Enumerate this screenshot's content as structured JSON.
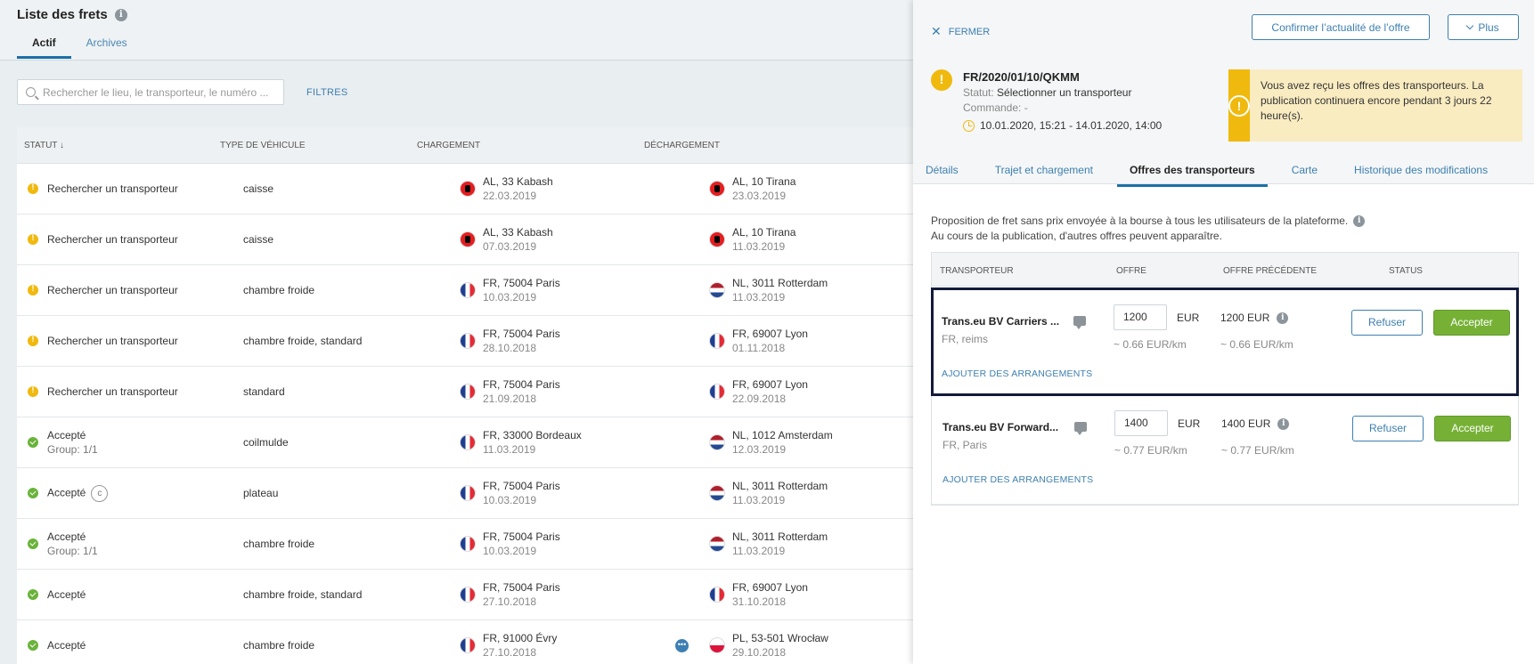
{
  "list": {
    "title": "Liste des frets",
    "tabs": [
      {
        "label": "Actif"
      },
      {
        "label": "Archives"
      }
    ],
    "search_placeholder": "Rechercher le lieu, le transporteur, le numéro ...",
    "filters_label": "FILTRES",
    "columns": {
      "status": "STATUT",
      "vehicle": "TYPE DE VÉHICULE",
      "loading": "CHARGEMENT",
      "unloading": "DÉCHARGEMENT"
    },
    "rows": [
      {
        "status": "Rechercher un transporteur",
        "status_sub": "",
        "kind": "warn",
        "vehicle": "caisse",
        "load_place": "AL, 33 Kabash",
        "load_date": "22.03.2019",
        "load_flag": "al",
        "unload_place": "AL, 10 Tirana",
        "unload_date": "23.03.2019",
        "unload_flag": "al"
      },
      {
        "status": "Rechercher un transporteur",
        "status_sub": "",
        "kind": "warn",
        "vehicle": "caisse",
        "load_place": "AL, 33 Kabash",
        "load_date": "07.03.2019",
        "load_flag": "al",
        "unload_place": "AL, 10 Tirana",
        "unload_date": "11.03.2019",
        "unload_flag": "al"
      },
      {
        "status": "Rechercher un transporteur",
        "status_sub": "",
        "kind": "warn",
        "vehicle": "chambre froide",
        "load_place": "FR, 75004 Paris",
        "load_date": "10.03.2019",
        "load_flag": "fr",
        "unload_place": "NL, 3011 Rotterdam",
        "unload_date": "11.03.2019",
        "unload_flag": "nl"
      },
      {
        "status": "Rechercher un transporteur",
        "status_sub": "",
        "kind": "warn",
        "vehicle": "chambre froide, standard",
        "load_place": "FR, 75004 Paris",
        "load_date": "28.10.2018",
        "load_flag": "fr",
        "unload_place": "FR, 69007 Lyon",
        "unload_date": "01.11.2018",
        "unload_flag": "fr"
      },
      {
        "status": "Rechercher un transporteur",
        "status_sub": "",
        "kind": "warn",
        "vehicle": "standard",
        "load_place": "FR, 75004 Paris",
        "load_date": "21.09.2018",
        "load_flag": "fr",
        "unload_place": "FR, 69007 Lyon",
        "unload_date": "22.09.2018",
        "unload_flag": "fr"
      },
      {
        "status": "Accepté",
        "status_sub": "Group: 1/1",
        "kind": "ok",
        "vehicle": "coilmulde",
        "load_place": "FR, 33000 Bordeaux",
        "load_date": "11.03.2019",
        "load_flag": "fr",
        "unload_place": "NL, 1012 Amsterdam",
        "unload_date": "12.03.2019",
        "unload_flag": "nl"
      },
      {
        "status": "Accepté",
        "status_sub": "",
        "badge": "c",
        "kind": "ok",
        "vehicle": "plateau",
        "load_place": "FR, 75004 Paris",
        "load_date": "10.03.2019",
        "load_flag": "fr",
        "unload_place": "NL, 3011 Rotterdam",
        "unload_date": "11.03.2019",
        "unload_flag": "nl"
      },
      {
        "status": "Accepté",
        "status_sub": "Group: 1/1",
        "kind": "ok",
        "vehicle": "chambre froide",
        "load_place": "FR, 75004 Paris",
        "load_date": "10.03.2019",
        "load_flag": "fr",
        "unload_place": "NL, 3011 Rotterdam",
        "unload_date": "11.03.2019",
        "unload_flag": "nl"
      },
      {
        "status": "Accepté",
        "status_sub": "",
        "kind": "ok",
        "vehicle": "chambre froide, standard",
        "load_place": "FR, 75004 Paris",
        "load_date": "27.10.2018",
        "load_flag": "fr",
        "unload_place": "FR, 69007 Lyon",
        "unload_date": "31.10.2018",
        "unload_flag": "fr"
      },
      {
        "status": "Accepté",
        "status_sub": "",
        "kind": "ok",
        "vehicle": "chambre froide",
        "load_place": "FR, 91000 Évry",
        "load_date": "27.10.2018",
        "load_flag": "fr",
        "unload_place": "PL, 53-501 Wrocław",
        "unload_date": "29.10.2018",
        "unload_flag": "pl",
        "chat": true
      }
    ]
  },
  "detail": {
    "close_label": "FERMER",
    "confirm_label": "Confirmer l’actualité de l’offre",
    "more_label": "Plus",
    "reference": "FR/2020/01/10/QKMM",
    "status_label": "Statut:",
    "status_value": "Sélectionner un transporteur",
    "order_label": "Commande:",
    "order_value": "-",
    "period": "10.01.2020, 15:21 - 14.01.2020, 14:00",
    "notice": "Vous avez reçu les offres des transporteurs. La publication continuera encore pendant 3 jours 22 heure(s).",
    "tabs": [
      {
        "label": "Détails"
      },
      {
        "label": "Trajet et chargement"
      },
      {
        "label": "Offres des transporteurs",
        "active": true
      },
      {
        "label": "Carte"
      },
      {
        "label": "Historique des modifications"
      }
    ],
    "proposal_line1": "Proposition de fret sans prix envoyée à la bourse à tous les utilisateurs de la plateforme.",
    "proposal_line2": "Au cours de la publication, d'autres offres peuvent apparaître.",
    "offer_columns": {
      "carrier": "TRANSPORTEUR",
      "offer": "OFFRE",
      "previous": "OFFRE PRÉCÉDENTE",
      "status": "STATUS"
    },
    "offers": [
      {
        "carrier": "Trans.eu BV Carriers ...",
        "location": "FR, reims",
        "price": "1200",
        "currency": "EUR",
        "perkm": "~ 0.66 EUR/km",
        "prev_price": "1200 EUR",
        "prev_perkm": "~ 0.66 EUR/km",
        "refuse": "Refuser",
        "accept": "Accepter",
        "arrange": "AJOUTER DES ARRANGEMENTS",
        "selected": true
      },
      {
        "carrier": "Trans.eu BV Forward...",
        "location": "FR, Paris",
        "price": "1400",
        "currency": "EUR",
        "perkm": "~ 0.77 EUR/km",
        "prev_price": "1400 EUR",
        "prev_perkm": "~ 0.77 EUR/km",
        "refuse": "Refuser",
        "accept": "Accepter",
        "arrange": "AJOUTER DES ARRANGEMENTS",
        "selected": false
      }
    ]
  }
}
